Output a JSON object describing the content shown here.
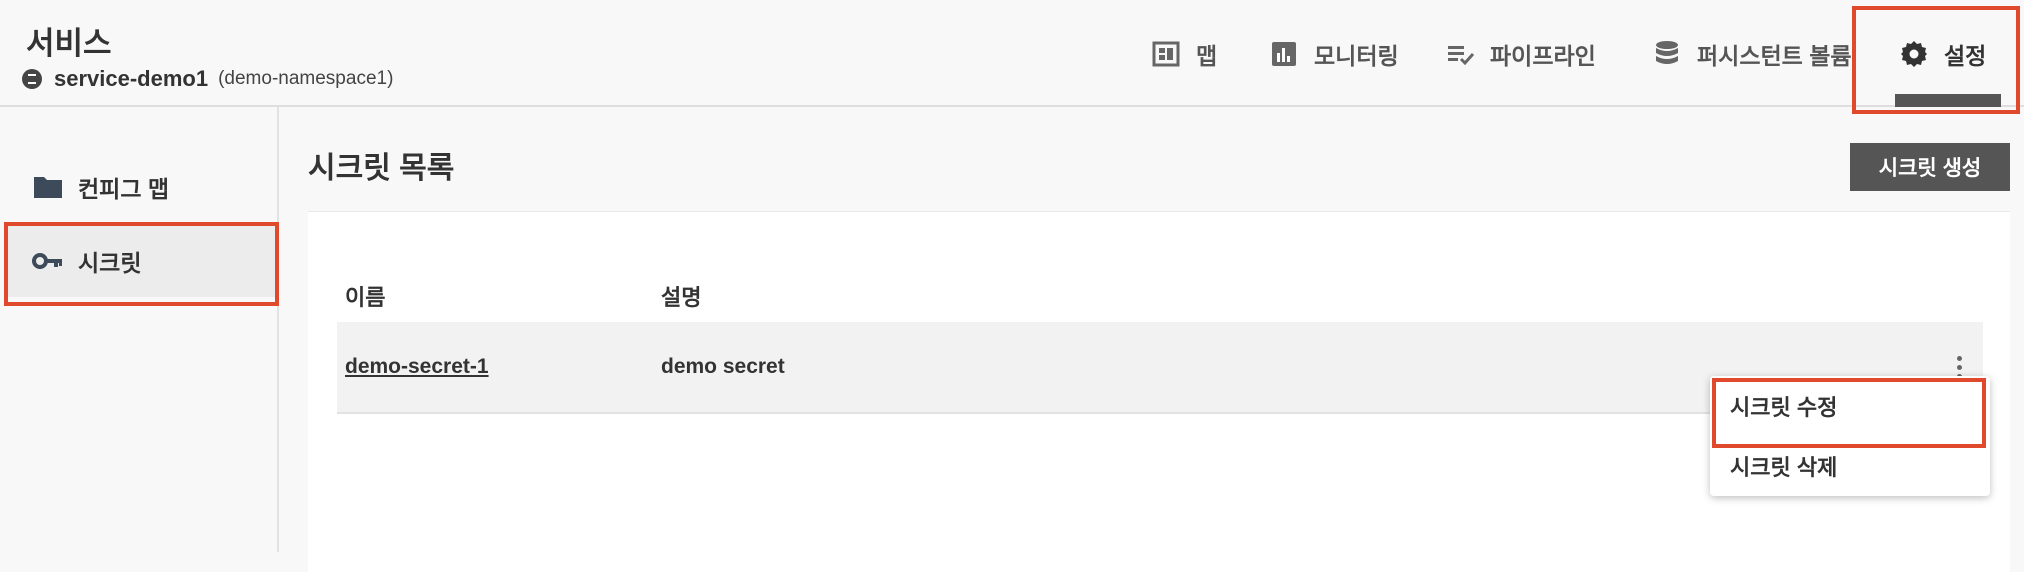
{
  "header": {
    "title": "서비스",
    "service_name": "service-demo1",
    "namespace": "(demo-namespace1)"
  },
  "nav": {
    "tabs": [
      {
        "label": "맵",
        "icon": "dashboard-icon"
      },
      {
        "label": "모니터링",
        "icon": "bar-chart-icon"
      },
      {
        "label": "파이프라인",
        "icon": "playlist-check-icon"
      },
      {
        "label": "퍼시스턴트 볼륨",
        "icon": "database-icon"
      },
      {
        "label": "설정",
        "icon": "gear-icon",
        "active": true
      }
    ]
  },
  "sidebar": {
    "items": [
      {
        "label": "컨피그 맵",
        "icon": "folder-icon"
      },
      {
        "label": "시크릿",
        "icon": "key-icon",
        "active": true
      }
    ]
  },
  "main": {
    "title": "시크릿 목록",
    "create_button": "시크릿 생성",
    "table": {
      "headers": [
        "이름",
        "설명"
      ],
      "rows": [
        {
          "name": "demo-secret-1",
          "description": "demo secret"
        }
      ]
    }
  },
  "context_menu": {
    "items": [
      "시크릿 수정",
      "시크릿 삭제"
    ]
  },
  "colors": {
    "highlight": "#e0492c",
    "button": "#555555"
  }
}
